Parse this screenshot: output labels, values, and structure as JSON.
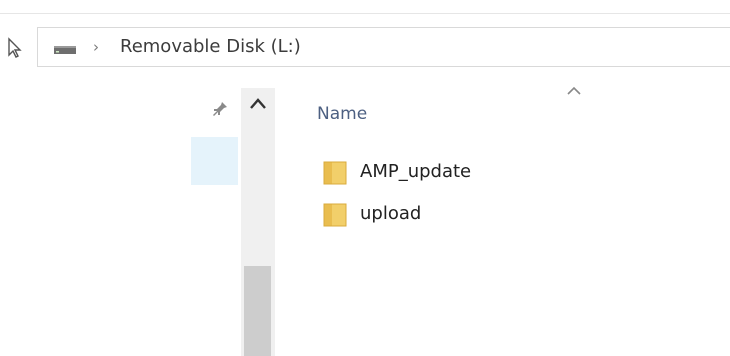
{
  "address_bar": {
    "separator": "›",
    "location": "Removable Disk (L:)"
  },
  "navigation_pane": {
    "pin_icon": "pin-icon",
    "scroll_up_icon": "chevron-up-icon"
  },
  "file_list": {
    "column_header": "Name",
    "sort_icon": "chevron-up-icon",
    "items": [
      {
        "name": "AMP_update",
        "icon": "folder-icon"
      },
      {
        "name": "upload",
        "icon": "folder-icon"
      }
    ]
  },
  "colors": {
    "folder": "#f2cf6a",
    "selection": "#e5f3fb",
    "header_text": "#4d6082"
  }
}
